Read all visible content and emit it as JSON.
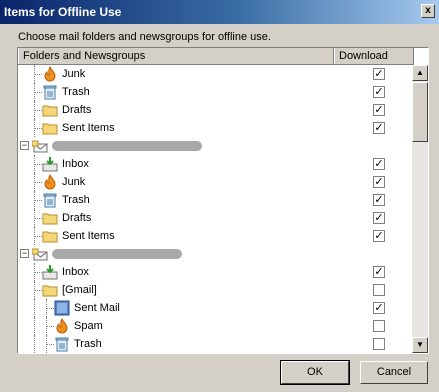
{
  "window": {
    "title": "Items for Offline Use",
    "close_glyph": "x"
  },
  "instructions": "Choose mail folders and newsgroups for offline use.",
  "columns": {
    "folders": "Folders and Newsgroups",
    "download": "Download"
  },
  "rows": [
    {
      "kind": "folder",
      "icon": "junk-icon",
      "label": "Junk",
      "checked": true
    },
    {
      "kind": "folder",
      "icon": "trash-icon",
      "label": "Trash",
      "checked": true
    },
    {
      "kind": "folder",
      "icon": "folder-icon",
      "label": "Drafts",
      "checked": true
    },
    {
      "kind": "folder",
      "icon": "folder-icon",
      "label": "Sent Items",
      "checked": true
    },
    {
      "kind": "account",
      "icon": "mail-account-icon",
      "label": "",
      "checked": null
    },
    {
      "kind": "folder",
      "icon": "inbox-icon",
      "label": "Inbox",
      "checked": true
    },
    {
      "kind": "folder",
      "icon": "junk-icon",
      "label": "Junk",
      "checked": true
    },
    {
      "kind": "folder",
      "icon": "trash-icon",
      "label": "Trash",
      "checked": true
    },
    {
      "kind": "folder",
      "icon": "folder-icon",
      "label": "Drafts",
      "checked": true
    },
    {
      "kind": "folder",
      "icon": "folder-icon",
      "label": "Sent Items",
      "checked": true
    },
    {
      "kind": "account",
      "icon": "mail-account-icon",
      "label": "",
      "checked": null
    },
    {
      "kind": "folder",
      "icon": "inbox-icon",
      "label": "Inbox",
      "checked": true
    },
    {
      "kind": "folder",
      "icon": "folder-icon",
      "label": "[Gmail]",
      "checked": false
    },
    {
      "kind": "subfolder",
      "icon": "sent-mail-icon",
      "label": "Sent Mail",
      "checked": true
    },
    {
      "kind": "subfolder",
      "icon": "junk-icon",
      "label": "Spam",
      "checked": false
    },
    {
      "kind": "subfolder",
      "icon": "trash-icon",
      "label": "Trash",
      "checked": false
    }
  ],
  "buttons": {
    "ok": "OK",
    "cancel": "Cancel"
  },
  "colors": {
    "titlebar_start": "#0a246a",
    "titlebar_end": "#a6caf0",
    "dialog_bg": "#d4d0c8"
  }
}
